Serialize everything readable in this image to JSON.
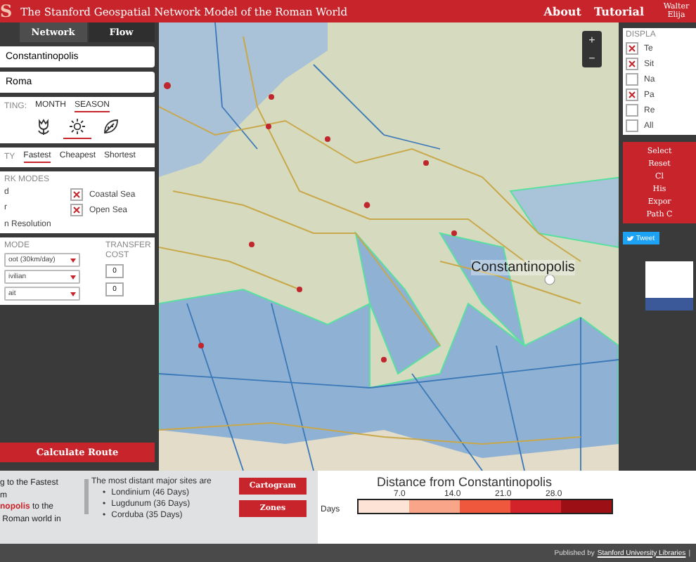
{
  "header": {
    "logo": "S",
    "title": "The Stanford Geospatial Network Model of the Roman World",
    "links": [
      "About",
      "Tutorial"
    ],
    "author": "Walter\nElija"
  },
  "left_panel": {
    "tabs": [
      {
        "label": "Network",
        "selected": true
      },
      {
        "label": "Flow",
        "selected": false
      }
    ],
    "start": "Constantinopolis",
    "destination": "Roma",
    "timing": {
      "label": "TING:",
      "options": [
        {
          "label": "MONTH",
          "selected": false
        },
        {
          "label": "SEASON",
          "selected": true
        }
      ],
      "seasons": [
        {
          "kind": "spring",
          "selected": false
        },
        {
          "kind": "summer",
          "selected": true
        },
        {
          "kind": "autumn",
          "selected": false
        }
      ]
    },
    "priority": {
      "label": "TY",
      "options": [
        {
          "label": "Fastest",
          "selected": true
        },
        {
          "label": "Cheapest",
          "selected": false
        },
        {
          "label": "Shortest",
          "selected": false
        }
      ]
    },
    "network_modes": {
      "label": "RK MODES",
      "cut_labels": [
        "d",
        "r",
        "n Resolution"
      ],
      "modes": [
        {
          "label": "Coastal Sea",
          "checked": true
        },
        {
          "label": "Open Sea",
          "checked": true
        }
      ]
    },
    "mode_section": {
      "label": "MODE",
      "transfer_label": "TRANSFER COST",
      "selects": [
        "oot (30km/day)",
        "ivilian",
        "ait"
      ],
      "costs": [
        "0",
        "0"
      ]
    },
    "calculate_button": "Calculate Route"
  },
  "map": {
    "place_label": "Constantinopolis",
    "zoom": [
      "+",
      "−"
    ]
  },
  "right_panel": {
    "label": "DISPLA",
    "layers": [
      {
        "label": "Te",
        "checked": true
      },
      {
        "label": "Sit",
        "checked": true
      },
      {
        "label": "Na",
        "checked": false
      },
      {
        "label": "Pa",
        "checked": true
      },
      {
        "label": "Re",
        "checked": false
      },
      {
        "label": "All",
        "checked": false
      }
    ],
    "buttons": [
      "Select",
      "Reset",
      "Cl",
      "His",
      "Expor",
      "Path C"
    ],
    "tweet": "Tweet"
  },
  "results": {
    "summary": "g to the Fastest\nm\n**nopolis** to the\n Roman world in",
    "intro": "The most distant major sites are",
    "sites": [
      {
        "marker": "•",
        "label": "Londinium (46 Days)"
      },
      {
        "marker": "•",
        "label": "Lugdunum (36 Days)"
      },
      {
        "marker": "•",
        "label": "Corduba (35 Days)"
      }
    ]
  },
  "view_buttons": [
    "Cartogram",
    "Zones"
  ],
  "legend": {
    "title": "Distance from Constantinopolis",
    "unit": "Days",
    "ticks": [
      "7.0",
      "14.0",
      "21.0",
      "28.0"
    ],
    "classes": [
      {
        "color": "#fde3d6"
      },
      {
        "color": "#f9a58a"
      },
      {
        "color": "#f0583e"
      },
      {
        "color": "#d2232a"
      },
      {
        "color": "#9b0f15"
      }
    ]
  },
  "footer": {
    "prefix": "Published by",
    "link": "Stanford University Libraries",
    "suffix": "|"
  }
}
